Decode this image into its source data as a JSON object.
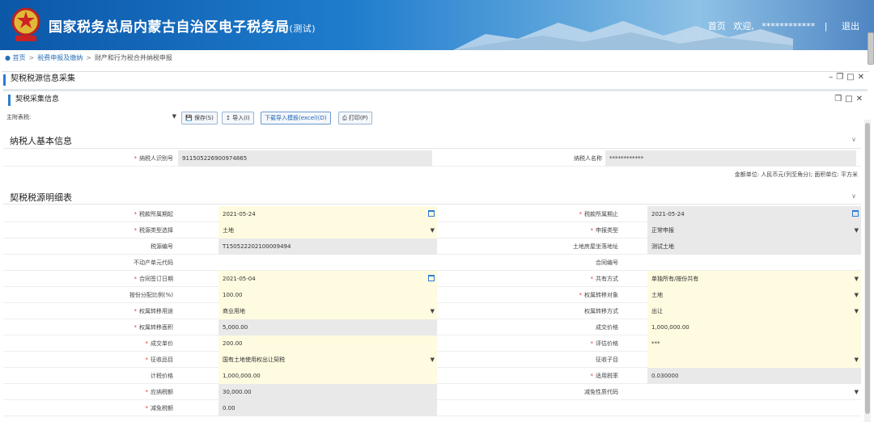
{
  "header": {
    "title": "国家税务总局内蒙古自治区电子税务局",
    "title_suffix": "(测试)",
    "emblem_text": "中国税务",
    "home": "首页",
    "welcome": "欢迎,",
    "user": "************",
    "logout": "退出",
    "colors": {
      "primary": "#1f72c4",
      "accent": "#2b7bd3",
      "required": "#e33333",
      "highlight": "#fffbe0"
    }
  },
  "breadcrumb": {
    "items": [
      "首页",
      "税费申报及缴纳",
      "财产和行为税合并纳税申报"
    ]
  },
  "outer_panel": {
    "title": "契税税源信息采集"
  },
  "inner_panel": {
    "title": "契税采集信息"
  },
  "toolbar": {
    "tax_select_label": "主附表税:",
    "save": "保存(S)",
    "import": "导入(I)",
    "download_template": "下载导入模板(excel)(D)",
    "print": "打印(P)"
  },
  "basic": {
    "title": "纳税人基本信息",
    "taxpayer_id_label": "纳税人识别号",
    "taxpayer_id": "911505226900974865",
    "taxpayer_name_label": "纳税人名称",
    "taxpayer_name": "************",
    "unit_note": "金额单位: 人民币元(列至角分); 面积单位: 平方米"
  },
  "detail": {
    "title": "契税税源明细表",
    "rows": [
      {
        "l_label": "税款所属期起",
        "l_req": true,
        "l_value": "2021-05-24",
        "l_style": "y",
        "l_icon": "cal",
        "r_label": "税款所属期止",
        "r_req": true,
        "r_value": "2021-05-24",
        "r_style": "g",
        "r_icon": "cal"
      },
      {
        "l_label": "税源类型选择",
        "l_req": true,
        "l_value": "土地",
        "l_style": "y",
        "l_icon": "dd",
        "r_label": "申报类型",
        "r_req": true,
        "r_value": "正常申报",
        "r_style": "g",
        "r_icon": "dd"
      },
      {
        "l_label": "税源编号",
        "l_req": false,
        "l_value": "T150522202100009494",
        "l_style": "g",
        "l_icon": "",
        "r_label": "土地房屋坐落地址",
        "r_req": false,
        "r_value": "测试土地",
        "r_style": "g",
        "r_icon": ""
      },
      {
        "l_label": "不动产单元代码",
        "l_req": false,
        "l_value": "",
        "l_style": "",
        "l_icon": "",
        "r_label": "合同编号",
        "r_req": false,
        "r_value": "",
        "r_style": "",
        "r_icon": ""
      },
      {
        "l_label": "合同签订日期",
        "l_req": true,
        "l_value": "2021-05-04",
        "l_style": "y",
        "l_icon": "cal",
        "r_label": "共有方式",
        "r_req": true,
        "r_value": "单独所有/按份共有",
        "r_style": "y",
        "r_icon": "dd"
      },
      {
        "l_label": "按份分配比例(%)",
        "l_req": false,
        "l_value": "100.00",
        "l_style": "y",
        "l_icon": "",
        "r_label": "权属转移对象",
        "r_req": true,
        "r_value": "土地",
        "r_style": "y",
        "r_icon": "dd"
      },
      {
        "l_label": "权属转移用途",
        "l_req": true,
        "l_value": "商业用地",
        "l_style": "y",
        "l_icon": "dd",
        "r_label": "权属转移方式",
        "r_req": false,
        "r_value": "出让",
        "r_style": "y",
        "r_icon": "dd"
      },
      {
        "l_label": "权属转移面积",
        "l_req": true,
        "l_value": "5,000.00",
        "l_style": "g",
        "l_icon": "",
        "r_label": "成交价格",
        "r_req": false,
        "r_value": "1,000,000.00",
        "r_style": "y",
        "r_icon": ""
      },
      {
        "l_label": "成交单价",
        "l_req": true,
        "l_value": "200.00",
        "l_style": "y",
        "l_icon": "",
        "r_label": "评估价格",
        "r_req": true,
        "r_value": "***",
        "r_style": "y",
        "r_icon": ""
      },
      {
        "l_label": "征收品目",
        "l_req": true,
        "l_value": "国有土地使用权出让契税",
        "l_style": "y",
        "l_icon": "dd",
        "r_label": "征收子目",
        "r_req": false,
        "r_value": "",
        "r_style": "y",
        "r_icon": "dd"
      },
      {
        "l_label": "计税价格",
        "l_req": false,
        "l_value": "1,000,000.00",
        "l_style": "y",
        "l_icon": "",
        "r_label": "适用税率",
        "r_req": true,
        "r_value": "0.030000",
        "r_style": "g",
        "r_icon": ""
      },
      {
        "l_label": "应纳税额",
        "l_req": true,
        "l_value": "30,000.00",
        "l_style": "g",
        "l_icon": "",
        "r_label": "减免性质代码",
        "r_req": false,
        "r_value": "",
        "r_style": "",
        "r_icon": "dd"
      },
      {
        "l_label": "减免税额",
        "l_req": true,
        "l_value": "0.00",
        "l_style": "g",
        "l_icon": "",
        "r_label": "",
        "r_req": false,
        "r_value": "",
        "r_style": "",
        "r_icon": ""
      }
    ]
  }
}
